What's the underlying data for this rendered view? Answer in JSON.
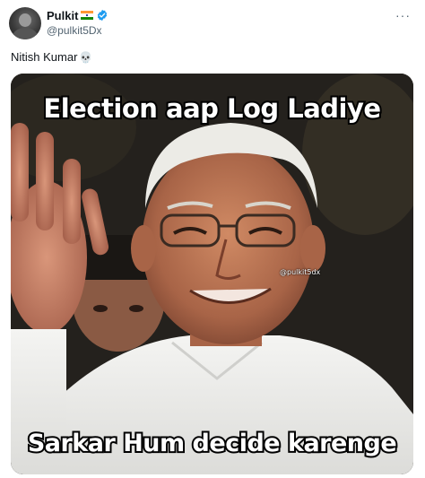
{
  "author": {
    "display_name": "Pulkit",
    "handle": "@pulkit5Dx",
    "verified": true,
    "flag": "india-flag-icon"
  },
  "menu": {
    "more_label": "···"
  },
  "post": {
    "text": "Nitish Kumar",
    "emoji": "💀"
  },
  "media": {
    "top_caption": "Election aap Log Ladiye",
    "bottom_caption": "Sarkar Hum decide karenge",
    "watermark": "@pulkit5dx",
    "accent_colors": {
      "verified": "#1d9bf0",
      "handle": "#536471"
    }
  }
}
